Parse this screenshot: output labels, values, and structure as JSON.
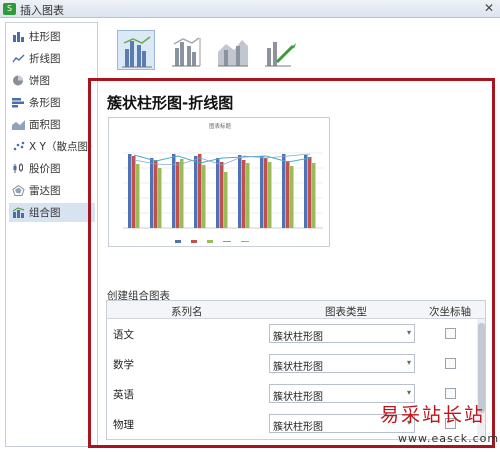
{
  "window": {
    "title": "插入图表",
    "app_icon_text": "S"
  },
  "sidebar": {
    "items": [
      {
        "label": "柱形图",
        "icon": "column-chart-icon"
      },
      {
        "label": "折线图",
        "icon": "line-chart-icon"
      },
      {
        "label": "饼图",
        "icon": "pie-chart-icon"
      },
      {
        "label": "条形图",
        "icon": "bar-chart-icon"
      },
      {
        "label": "面积图",
        "icon": "area-chart-icon"
      },
      {
        "label": "X Y（散点图）",
        "icon": "scatter-chart-icon"
      },
      {
        "label": "股价图",
        "icon": "stock-chart-icon"
      },
      {
        "label": "雷达图",
        "icon": "radar-chart-icon"
      },
      {
        "label": "组合图",
        "icon": "combo-chart-icon"
      }
    ],
    "active_index": 8
  },
  "type_strip": {
    "thumbnails": [
      "clustered-column-line-icon",
      "clustered-column-line-secondary-icon",
      "stacked-area-column-icon",
      "custom-combo-icon"
    ],
    "selected_index": 0
  },
  "main": {
    "heading": "簇状柱形图-折线图",
    "preview_title": "图表标题",
    "section_label": "创建组合图表",
    "table": {
      "headers": [
        "系列名",
        "图表类型",
        "次坐标轴"
      ],
      "rows": [
        {
          "name": "语文",
          "type": "簇状柱形图"
        },
        {
          "name": "数学",
          "type": "簇状柱形图"
        },
        {
          "name": "英语",
          "type": "簇状柱形图"
        },
        {
          "name": "物理",
          "type": "簇状柱形图"
        }
      ]
    }
  },
  "colors": {
    "accent": "#a7161e",
    "selection": "#d7e3f1"
  },
  "watermark": {
    "text": "易采站长站",
    "url": "www.easck.com"
  }
}
